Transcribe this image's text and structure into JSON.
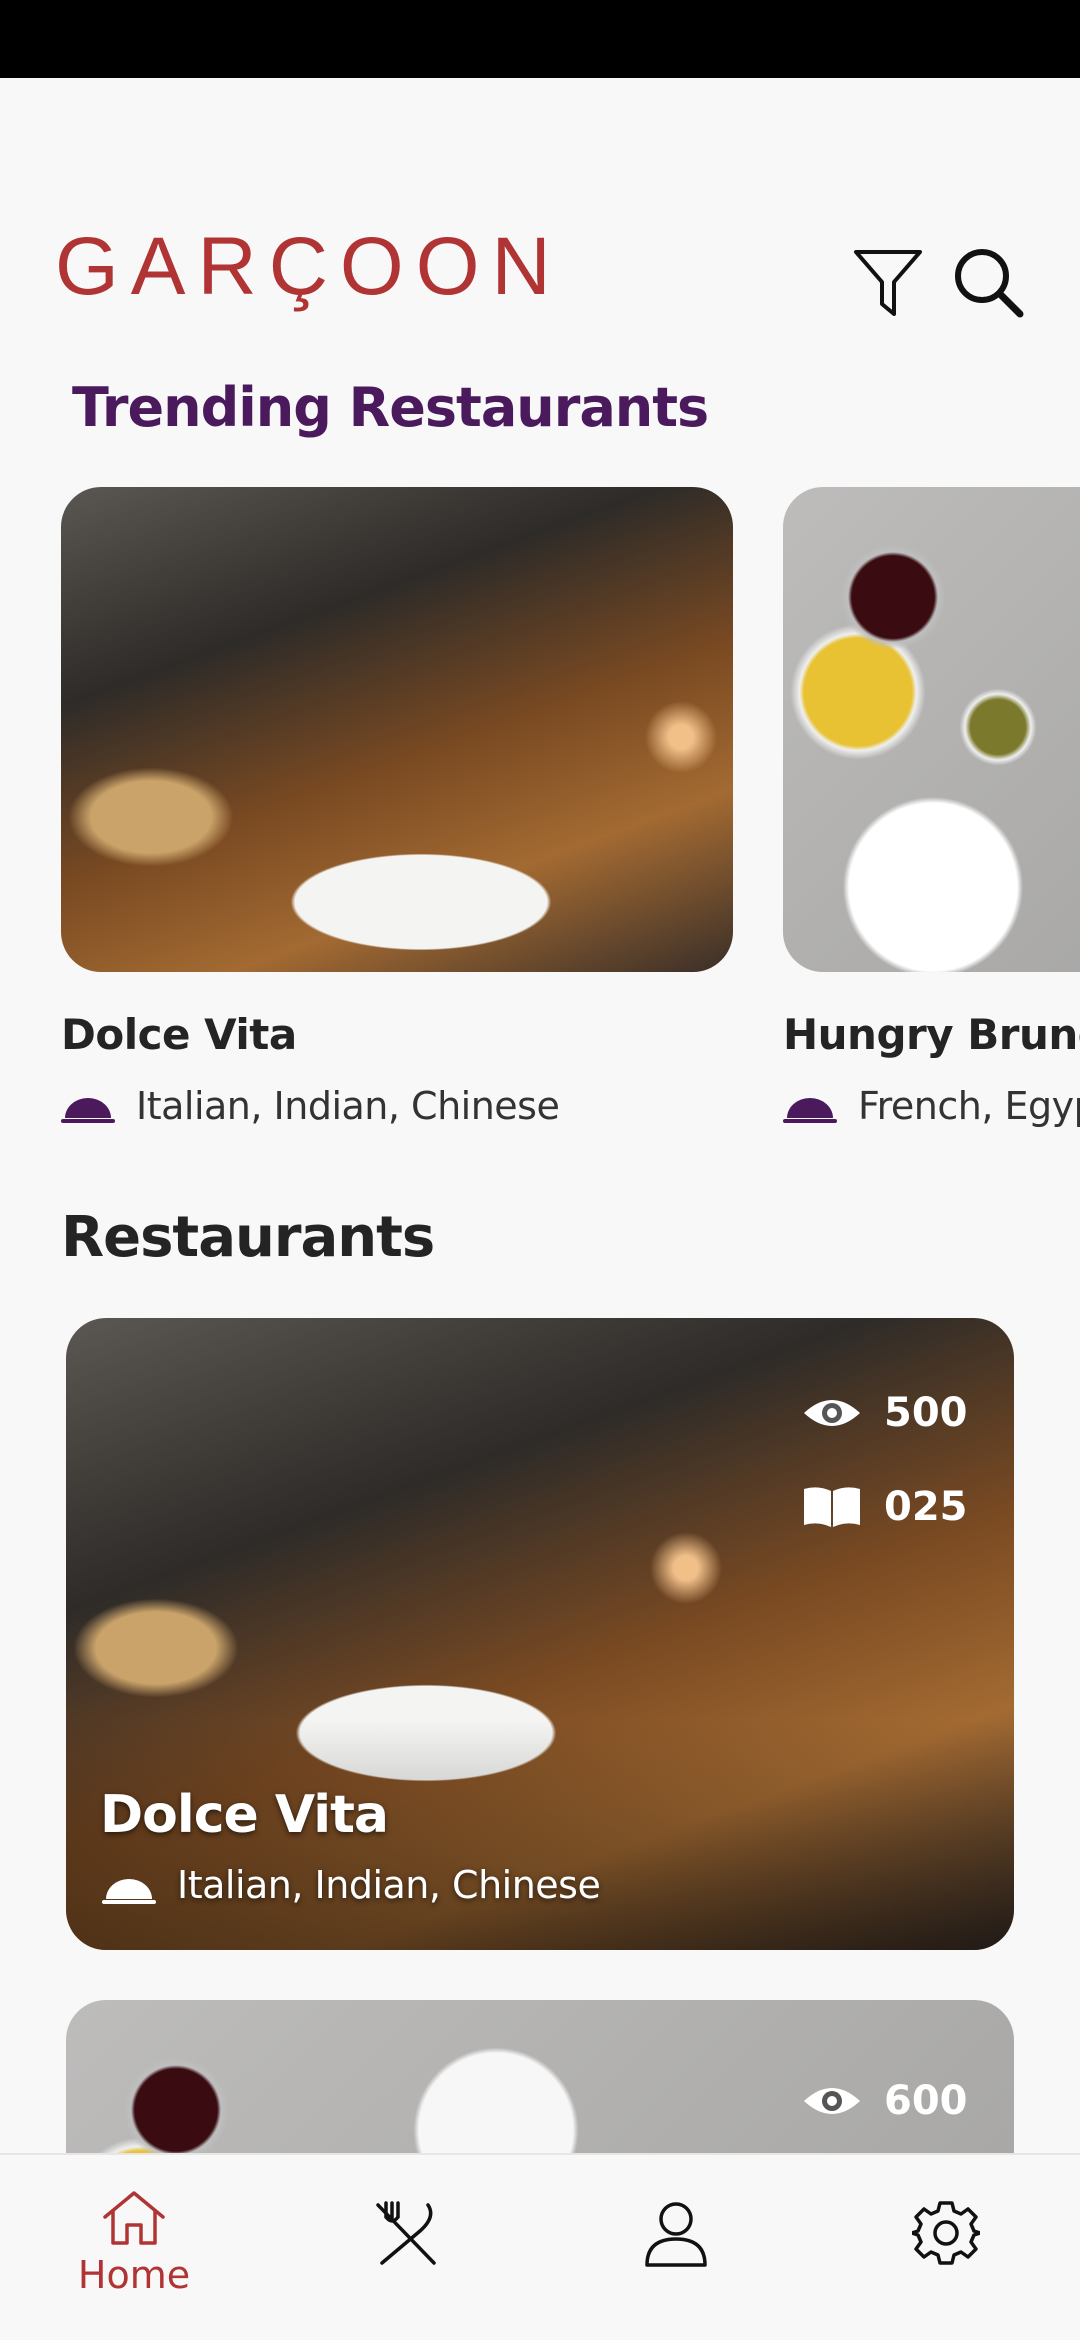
{
  "app": {
    "brand": "GARÇOON"
  },
  "header": {
    "icons": [
      "filter-icon",
      "search-icon"
    ]
  },
  "trending": {
    "title": "Trending Restaurants",
    "items": [
      {
        "name": "Dolce Vita",
        "cuisines": "Italian, Indian, Chinese"
      },
      {
        "name": "Hungry Brunch",
        "cuisines": "French, Egyp"
      }
    ]
  },
  "restaurants": {
    "title": "Restaurants",
    "items": [
      {
        "name": "Dolce Vita",
        "cuisines": "Italian, Indian, Chinese",
        "views": "500",
        "reads": "025"
      },
      {
        "views": "600"
      }
    ]
  },
  "nav": {
    "items": [
      {
        "icon": "home-icon",
        "label": "Home",
        "active": true
      },
      {
        "icon": "utensils-icon"
      },
      {
        "icon": "profile-icon"
      },
      {
        "icon": "settings-icon"
      }
    ]
  },
  "colors": {
    "brand": "#b03434",
    "trending_title": "#4a1a5c",
    "cloche": "#4a1a5c"
  }
}
